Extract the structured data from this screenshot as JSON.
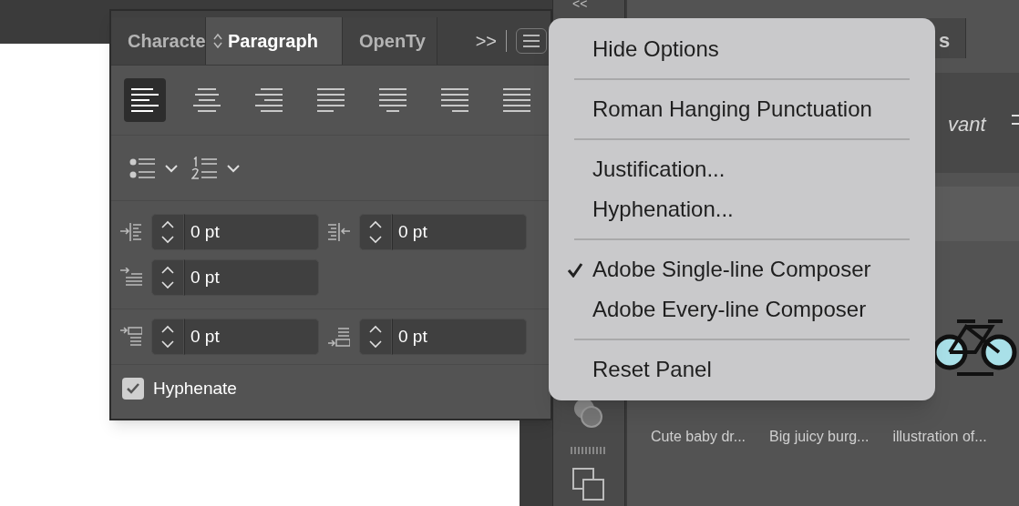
{
  "paragraph_panel": {
    "tabs": [
      {
        "label": "Characte",
        "selected": false
      },
      {
        "label": "Paragraph",
        "selected": true
      },
      {
        "label": "OpenTy",
        "selected": false
      }
    ],
    "overflow": ">>",
    "alignment": [
      {
        "kind": "left",
        "selected": true
      },
      {
        "kind": "center",
        "selected": false
      },
      {
        "kind": "right",
        "selected": false
      },
      {
        "kind": "justify-left",
        "selected": false
      },
      {
        "kind": "justify-center",
        "selected": false
      },
      {
        "kind": "justify-right",
        "selected": false
      },
      {
        "kind": "justify-all",
        "selected": false
      }
    ],
    "lists": [
      {
        "kind": "bullet"
      },
      {
        "kind": "numbered"
      }
    ],
    "spacing_rows": [
      [
        {
          "kind": "left-indent",
          "value": "0 pt"
        },
        {
          "kind": "right-indent",
          "value": "0 pt"
        }
      ],
      [
        {
          "kind": "first-line-indent",
          "value": "0 pt"
        }
      ],
      [
        {
          "kind": "space-before",
          "value": "0 pt"
        },
        {
          "kind": "space-after",
          "value": "0 pt"
        }
      ]
    ],
    "hyphenate": {
      "label": "Hyphenate",
      "checked": true
    }
  },
  "panel_menu": {
    "groups": [
      [
        {
          "label": "Hide Options",
          "checked": false
        }
      ],
      [
        {
          "label": "Roman Hanging Punctuation",
          "checked": false
        }
      ],
      [
        {
          "label": "Justification...",
          "checked": false
        },
        {
          "label": "Hyphenation...",
          "checked": false
        }
      ],
      [
        {
          "label": "Adobe Single-line Composer",
          "checked": true
        },
        {
          "label": "Adobe Every-line Composer",
          "checked": false
        }
      ],
      [
        {
          "label": "Reset Panel",
          "checked": false
        }
      ]
    ]
  },
  "dock": {
    "collapse": "<<",
    "tab_fragment": "s",
    "text_fragment": "vant",
    "captions": [
      "Cute baby dr...",
      "Big juicy burg...",
      "illustration of..."
    ]
  }
}
